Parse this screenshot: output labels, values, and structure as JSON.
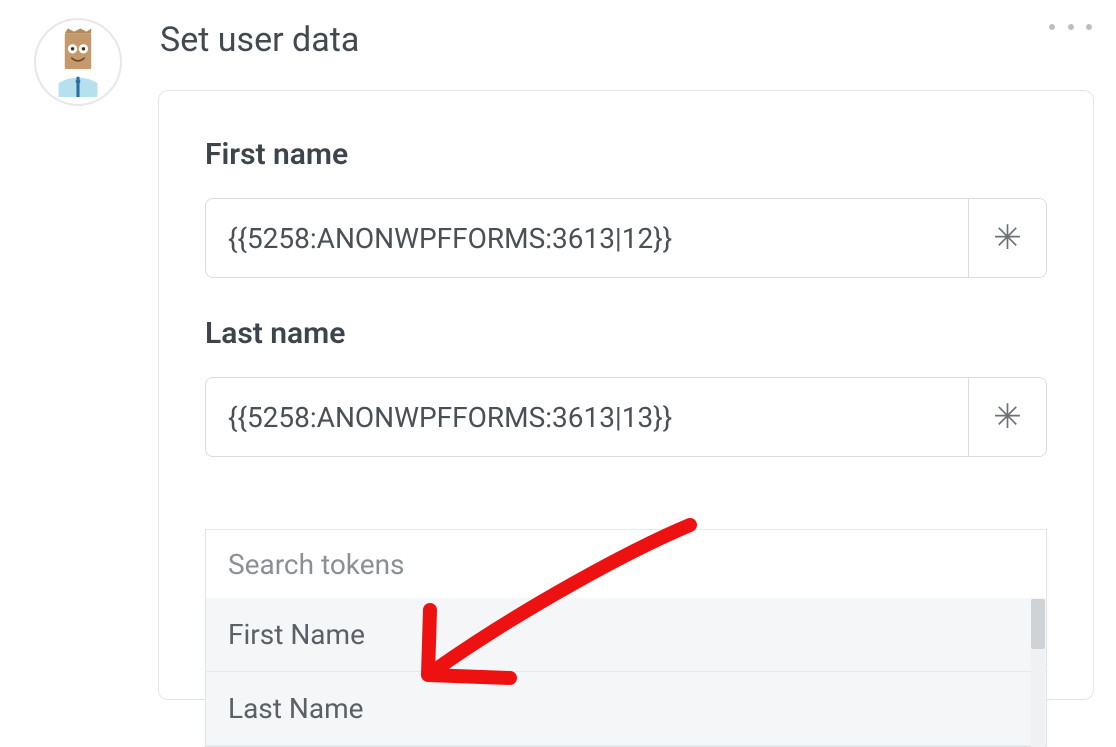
{
  "heading": "Set user data",
  "fields": {
    "first_name": {
      "label": "First name",
      "value": "{{5258:ANONWPFFORMS:3613|12}}"
    },
    "last_name": {
      "label": "Last name",
      "value": "{{5258:ANONWPFFORMS:3613|13}}"
    }
  },
  "token_button_glyph": "✳",
  "dropdown": {
    "search_placeholder": "Search tokens",
    "options": [
      "First Name",
      "Last Name"
    ]
  },
  "icons": {
    "more": "more-horizontal-icon",
    "avatar": "paper-bag-avatar"
  }
}
